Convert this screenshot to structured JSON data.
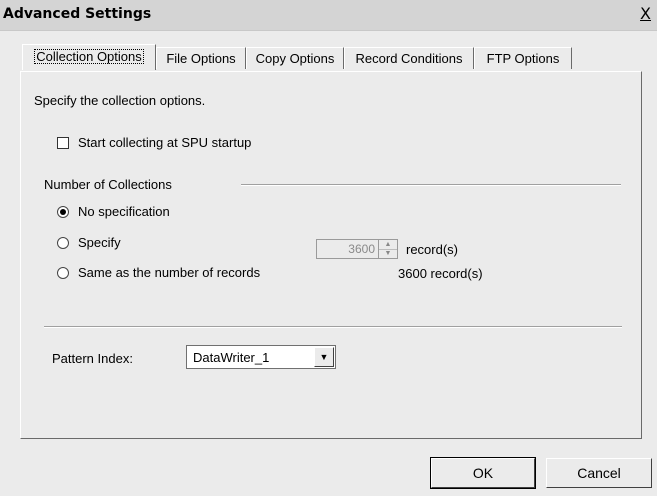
{
  "window": {
    "title": "Advanced Settings",
    "close_label": "X"
  },
  "tabs": [
    {
      "label": "Collection Options"
    },
    {
      "label": "File Options"
    },
    {
      "label": "Copy Options"
    },
    {
      "label": "Record Conditions"
    },
    {
      "label": "FTP Options"
    }
  ],
  "panel": {
    "description": "Specify the collection options.",
    "startup_checkbox": {
      "label": "Start collecting at SPU startup",
      "checked": false
    },
    "collections_group": {
      "title": "Number of Collections",
      "options": [
        {
          "label": "No specification",
          "selected": true
        },
        {
          "label": "Specify",
          "selected": false
        },
        {
          "label": "Same as the number of records",
          "selected": false
        }
      ],
      "specify_value": "3600",
      "specify_unit": "record(s)",
      "same_as_value": "3600 record(s)"
    },
    "pattern_index": {
      "label": "Pattern Index:",
      "value": "DataWriter_1"
    }
  },
  "footer": {
    "ok_label": "OK",
    "cancel_label": "Cancel"
  }
}
